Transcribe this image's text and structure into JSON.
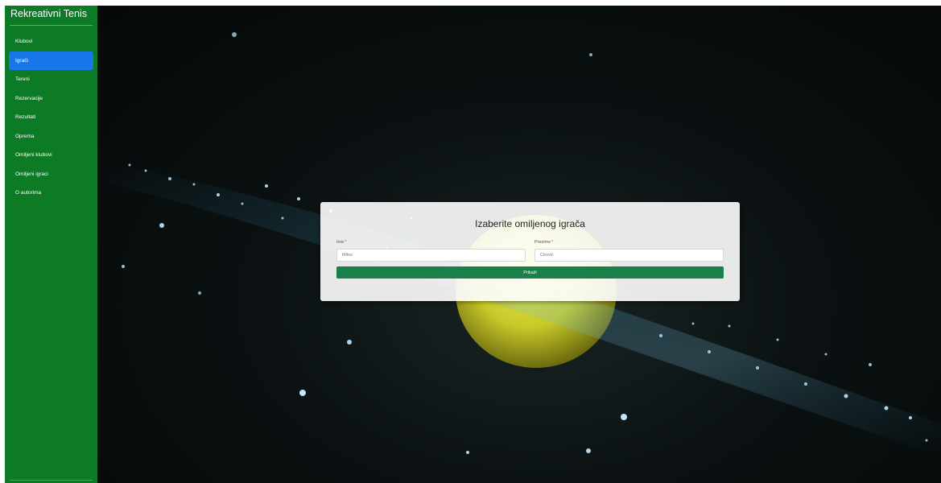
{
  "sidebar": {
    "brand": "Rekreativni Tenis",
    "accent": "#0d7a25",
    "active_color": "#1777e8",
    "items": [
      {
        "label": "Klubovi",
        "active": false
      },
      {
        "label": "Igrači",
        "active": true
      },
      {
        "label": "Tereni",
        "active": false
      },
      {
        "label": "Rezervacije",
        "active": false
      },
      {
        "label": "Rezultati",
        "active": false
      },
      {
        "label": "Oprema",
        "active": false
      },
      {
        "label": "Omiljeni klubovi",
        "active": false
      },
      {
        "label": "Omiljeni igraci",
        "active": false
      },
      {
        "label": "O autorima",
        "active": false
      }
    ]
  },
  "background": {
    "icon": "tennis-ball-photo-icon"
  },
  "form": {
    "title": "Izaberite omiljenog igrača",
    "first_name": {
      "label": "Ime",
      "required_mark": "*",
      "value": "Milos"
    },
    "last_name": {
      "label": "Prezime",
      "required_mark": "*",
      "value": "Cirovic"
    },
    "submit_label": "Prikaži",
    "submit_color": "#1a7f48"
  }
}
